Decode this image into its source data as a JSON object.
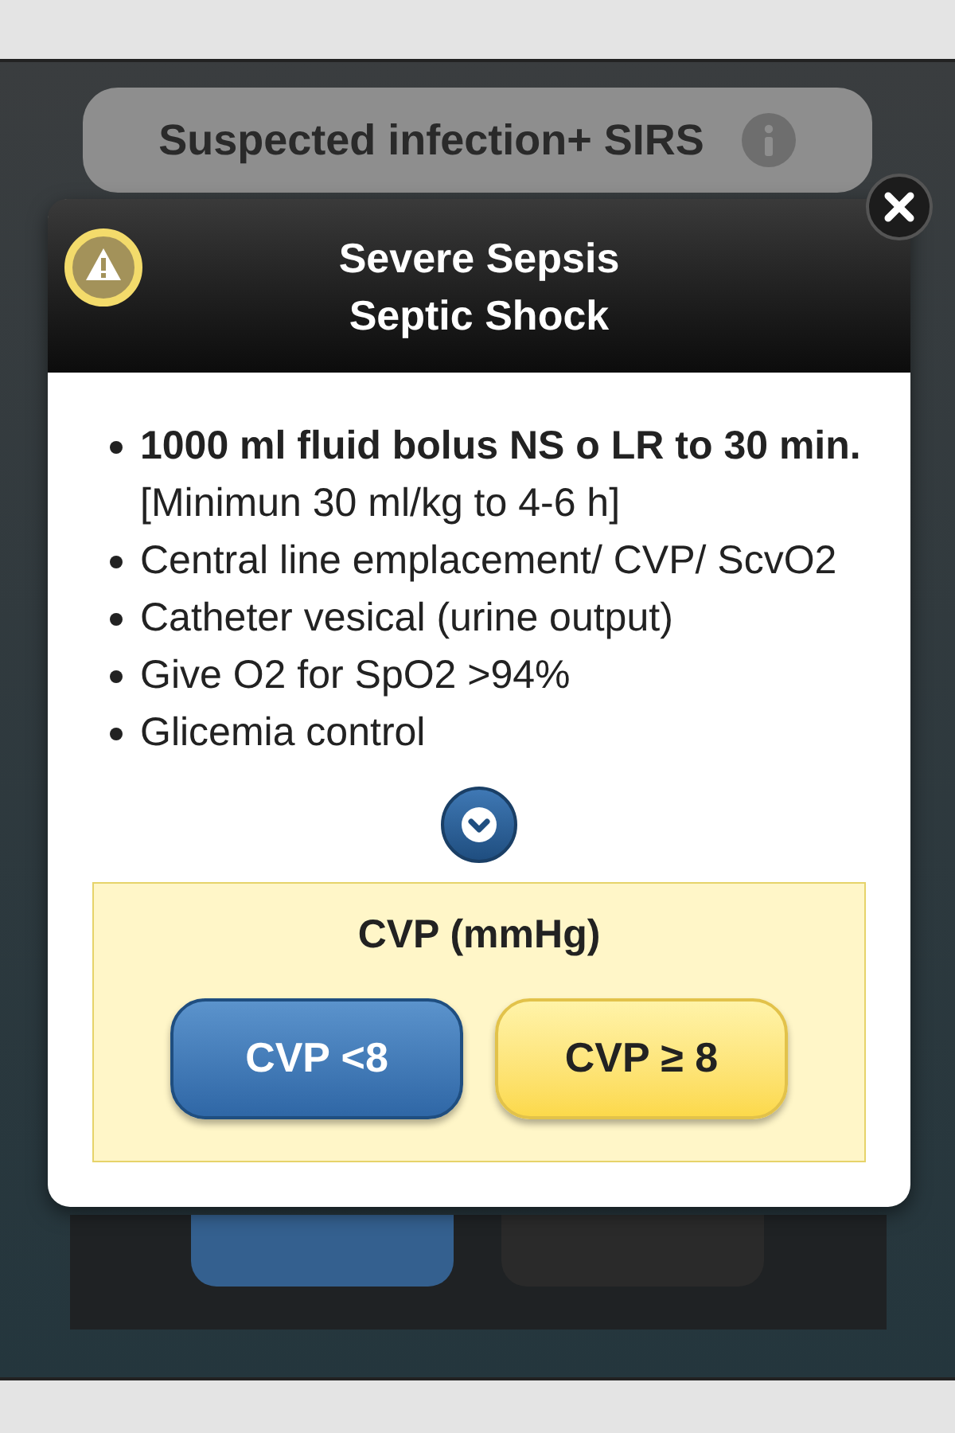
{
  "background": {
    "title": "Suspected infection+ SIRS"
  },
  "dialog": {
    "title_lines": [
      "Severe Sepsis",
      "Septic Shock"
    ],
    "items": [
      "**1000 ml fluid bolus NS o LR to 30 min.** [Minimun 30 ml/kg to 4-6 h]",
      "Central line emplacement/ CVP/ ScvO2",
      "Catheter vesical (urine output)",
      "Give O2 for SpO2 >94%",
      "Glicemia control"
    ],
    "question": {
      "title": "CVP (mmHg)",
      "options": [
        {
          "label": "CVP <8",
          "kind": "blue"
        },
        {
          "label": "CVP ≥ 8",
          "kind": "yellow"
        }
      ]
    }
  }
}
